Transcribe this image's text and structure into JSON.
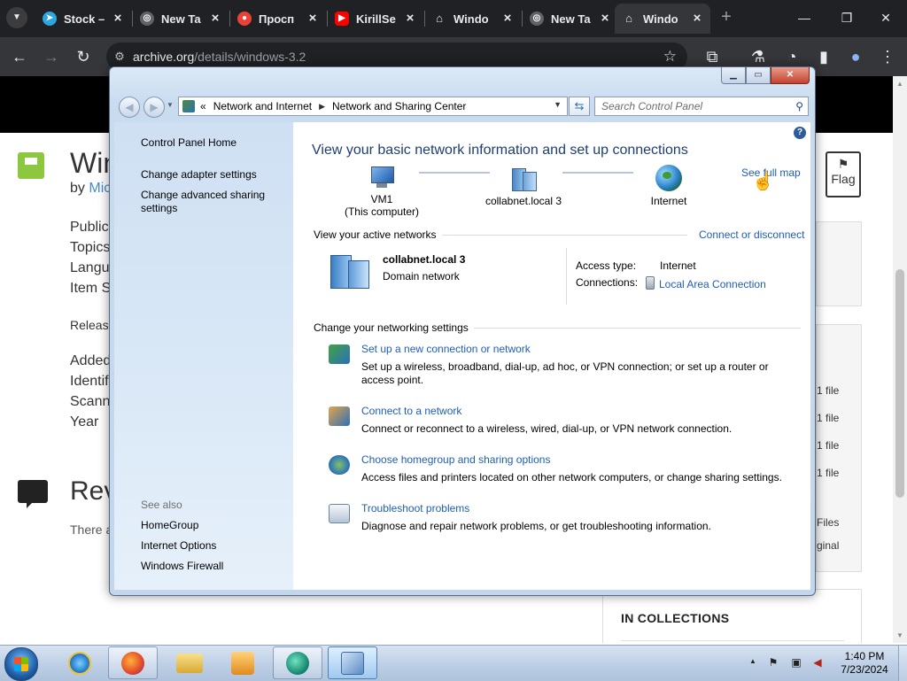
{
  "browser": {
    "tabs": [
      {
        "title": "Stock –",
        "favicon": "telegram-icon",
        "color": "#2ca5e0"
      },
      {
        "title": "New Ta",
        "favicon": "globe-icon",
        "color": "#5f6368"
      },
      {
        "title": "Просп",
        "favicon": "map-pin-icon",
        "color": "#ea4335"
      },
      {
        "title": "KirillSe",
        "favicon": "youtube-icon",
        "color": "#ff0000"
      },
      {
        "title": "Windo",
        "favicon": "archive-icon",
        "color": "#5f6368"
      },
      {
        "title": "New Ta",
        "favicon": "globe-icon",
        "color": "#5f6368"
      },
      {
        "title": "Windo",
        "favicon": "archive-icon",
        "color": "#5f6368"
      }
    ],
    "active_tab": 6,
    "url_domain": "archive.org",
    "url_path": "/details/windows-3.2"
  },
  "archive_page": {
    "title": "Win",
    "by_label": "by",
    "by_author": "Mic",
    "meta_labels_1": [
      "Public",
      "Topics",
      "Langu",
      "Item S"
    ],
    "release_label": "Releas",
    "meta_labels_2": [
      "Added",
      "Identif",
      "Scann",
      "Year"
    ],
    "reviews_title": "Rev",
    "reviews_text": "There a",
    "flag_label": "Flag",
    "file_counts": [
      "1 file",
      "1 file",
      "1 file",
      "1 file"
    ],
    "files_label": "Files",
    "original_label": "ginal",
    "collections_title": "IN COLLECTIONS"
  },
  "control_panel": {
    "breadcrumb": [
      "Network and Internet",
      "Network and Sharing Center"
    ],
    "breadcrumb_prefix": "«",
    "search_placeholder": "Search Control Panel",
    "sidebar": {
      "links": [
        "Control Panel Home",
        "Change adapter settings",
        "Change advanced sharing settings"
      ],
      "see_also_label": "See also",
      "see_also_links": [
        "HomeGroup",
        "Internet Options",
        "Windows Firewall"
      ]
    },
    "heading": "View your basic network information and set up connections",
    "see_full_map": "See full map",
    "network_map": {
      "computer_name": "VM1",
      "computer_sub": "(This computer)",
      "network_name": "collabnet.local  3",
      "internet": "Internet"
    },
    "active_networks_label": "View your active networks",
    "connect_disconnect": "Connect or disconnect",
    "active_network": {
      "name": "collabnet.local  3",
      "type": "Domain network",
      "access_type_label": "Access type:",
      "access_type_value": "Internet",
      "connections_label": "Connections:",
      "connections_value": "Local Area Connection"
    },
    "change_settings_label": "Change your networking settings",
    "tasks": [
      {
        "link": "Set up a new connection or network",
        "desc": "Set up a wireless, broadband, dial-up, ad hoc, or VPN connection; or set up a router or access point.",
        "icon": "new-connection-icon"
      },
      {
        "link": "Connect to a network",
        "desc": "Connect or reconnect to a wireless, wired, dial-up, or VPN network connection.",
        "icon": "connect-network-icon"
      },
      {
        "link": "Choose homegroup and sharing options",
        "desc": "Access files and printers located on other network computers, or change sharing settings.",
        "icon": "homegroup-icon"
      },
      {
        "link": "Troubleshoot problems",
        "desc": "Diagnose and repair network problems, or get troubleshooting information.",
        "icon": "troubleshoot-icon"
      }
    ]
  },
  "taskbar": {
    "apps": [
      "internet-explorer-icon",
      "firefox-icon",
      "file-explorer-icon",
      "media-player-icon",
      "chrome-like-icon",
      "control-panel-icon"
    ],
    "time": "1:40 PM",
    "date": "7/23/2024"
  }
}
